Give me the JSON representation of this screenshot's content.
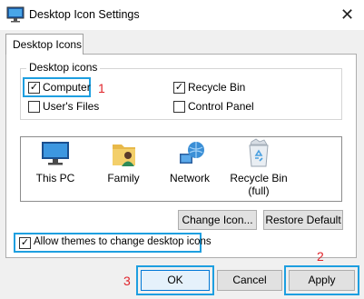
{
  "window": {
    "title": "Desktop Icon Settings",
    "close_glyph": "✕"
  },
  "tab": {
    "label": "Desktop Icons"
  },
  "group": {
    "label": "Desktop icons",
    "items": [
      {
        "label": "Computer",
        "checked": true
      },
      {
        "label": "Recycle Bin",
        "checked": true
      },
      {
        "label": "User's Files",
        "checked": false
      },
      {
        "label": "Control Panel",
        "checked": false
      }
    ]
  },
  "icons": [
    {
      "label": "This PC",
      "icon": "monitor-icon"
    },
    {
      "label": "Family",
      "icon": "user-folder-icon"
    },
    {
      "label": "Network",
      "icon": "network-globe-icon"
    },
    {
      "label": "Recycle Bin",
      "label2": "(full)",
      "icon": "recycle-bin-full-icon"
    }
  ],
  "buttons": {
    "change_icon": "Change Icon...",
    "restore_default": "Restore Default",
    "ok": "OK",
    "cancel": "Cancel",
    "apply": "Apply"
  },
  "allow_themes": {
    "label": "Allow themes to change desktop icons",
    "checked": true
  },
  "annotations": {
    "one": "1",
    "two": "2",
    "three": "3"
  },
  "colors": {
    "highlight": "#1e9fe0",
    "annotation": "#e0242b"
  }
}
